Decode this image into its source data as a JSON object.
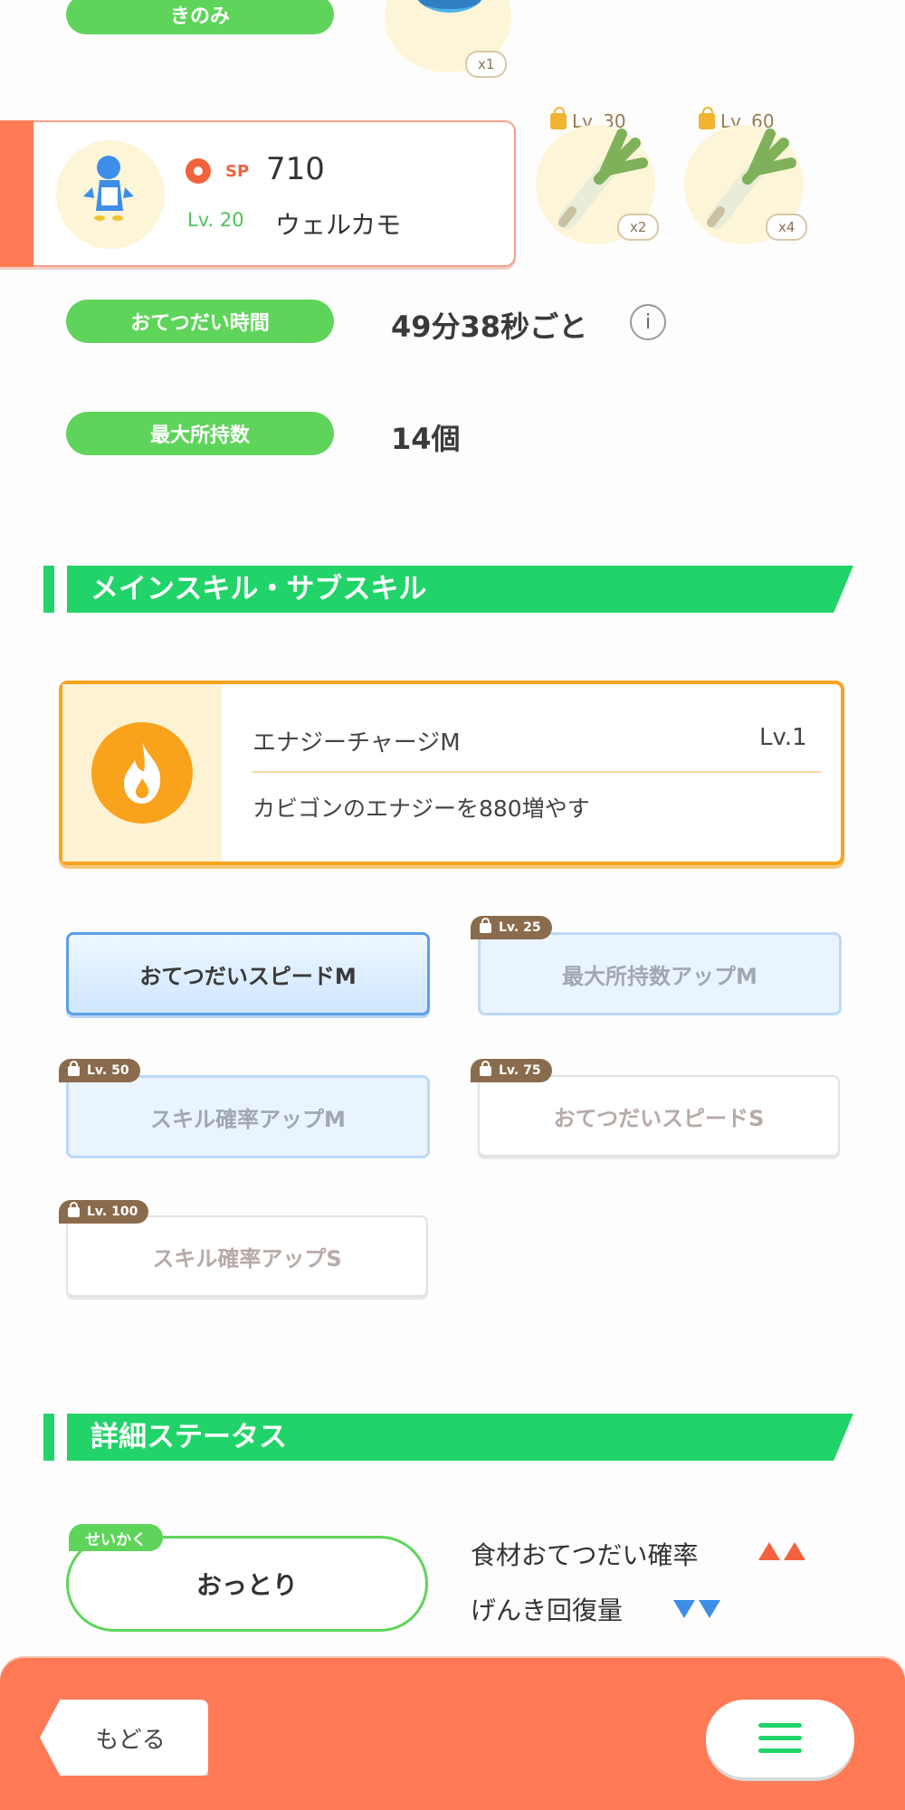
{
  "berry": {
    "label": "きのみ",
    "quantity": "x1"
  },
  "pokemon_card": {
    "sp_label": "SP",
    "sp_value": "710",
    "level": "Lv. 20",
    "name": "ウェルカモ"
  },
  "ingredients": [
    {
      "lock_level": "Lv. 30",
      "quantity": "x2"
    },
    {
      "lock_level": "Lv. 60",
      "quantity": "x4"
    }
  ],
  "help_time": {
    "label": "おてつだい時間",
    "value": "49分38秒ごと",
    "info_icon": "i"
  },
  "max_carry": {
    "label": "最大所持数",
    "value": "14個"
  },
  "skills_section": {
    "title": "メインスキル・サブスキル"
  },
  "main_skill": {
    "name": "エナジーチャージM",
    "level": "Lv.1",
    "description": "カビゴンのエナジーを880増やす",
    "icon": "flame-icon"
  },
  "sub_skills": [
    {
      "label": "おてつだいスピードM",
      "lock": ""
    },
    {
      "label": "最大所持数アップM",
      "lock": "Lv. 25"
    },
    {
      "label": "スキル確率アップM",
      "lock": "Lv. 50"
    },
    {
      "label": "おてつだいスピードS",
      "lock": "Lv. 75"
    },
    {
      "label": "スキル確率アップS",
      "lock": "Lv. 100"
    }
  ],
  "detail_section": {
    "title": "詳細ステータス"
  },
  "nature": {
    "tag": "せいかく",
    "value": "おっとり",
    "up_stat": "食材おてつだい確率",
    "down_stat": "げんき回復量"
  },
  "footer": {
    "back_label": "もどる"
  },
  "colors": {
    "green": "#22d369",
    "pill_green": "#5fd45a",
    "orange": "#ff7a55",
    "skill_orange": "#f9a21b",
    "up": "#f2623c",
    "down": "#3d8ee8"
  }
}
